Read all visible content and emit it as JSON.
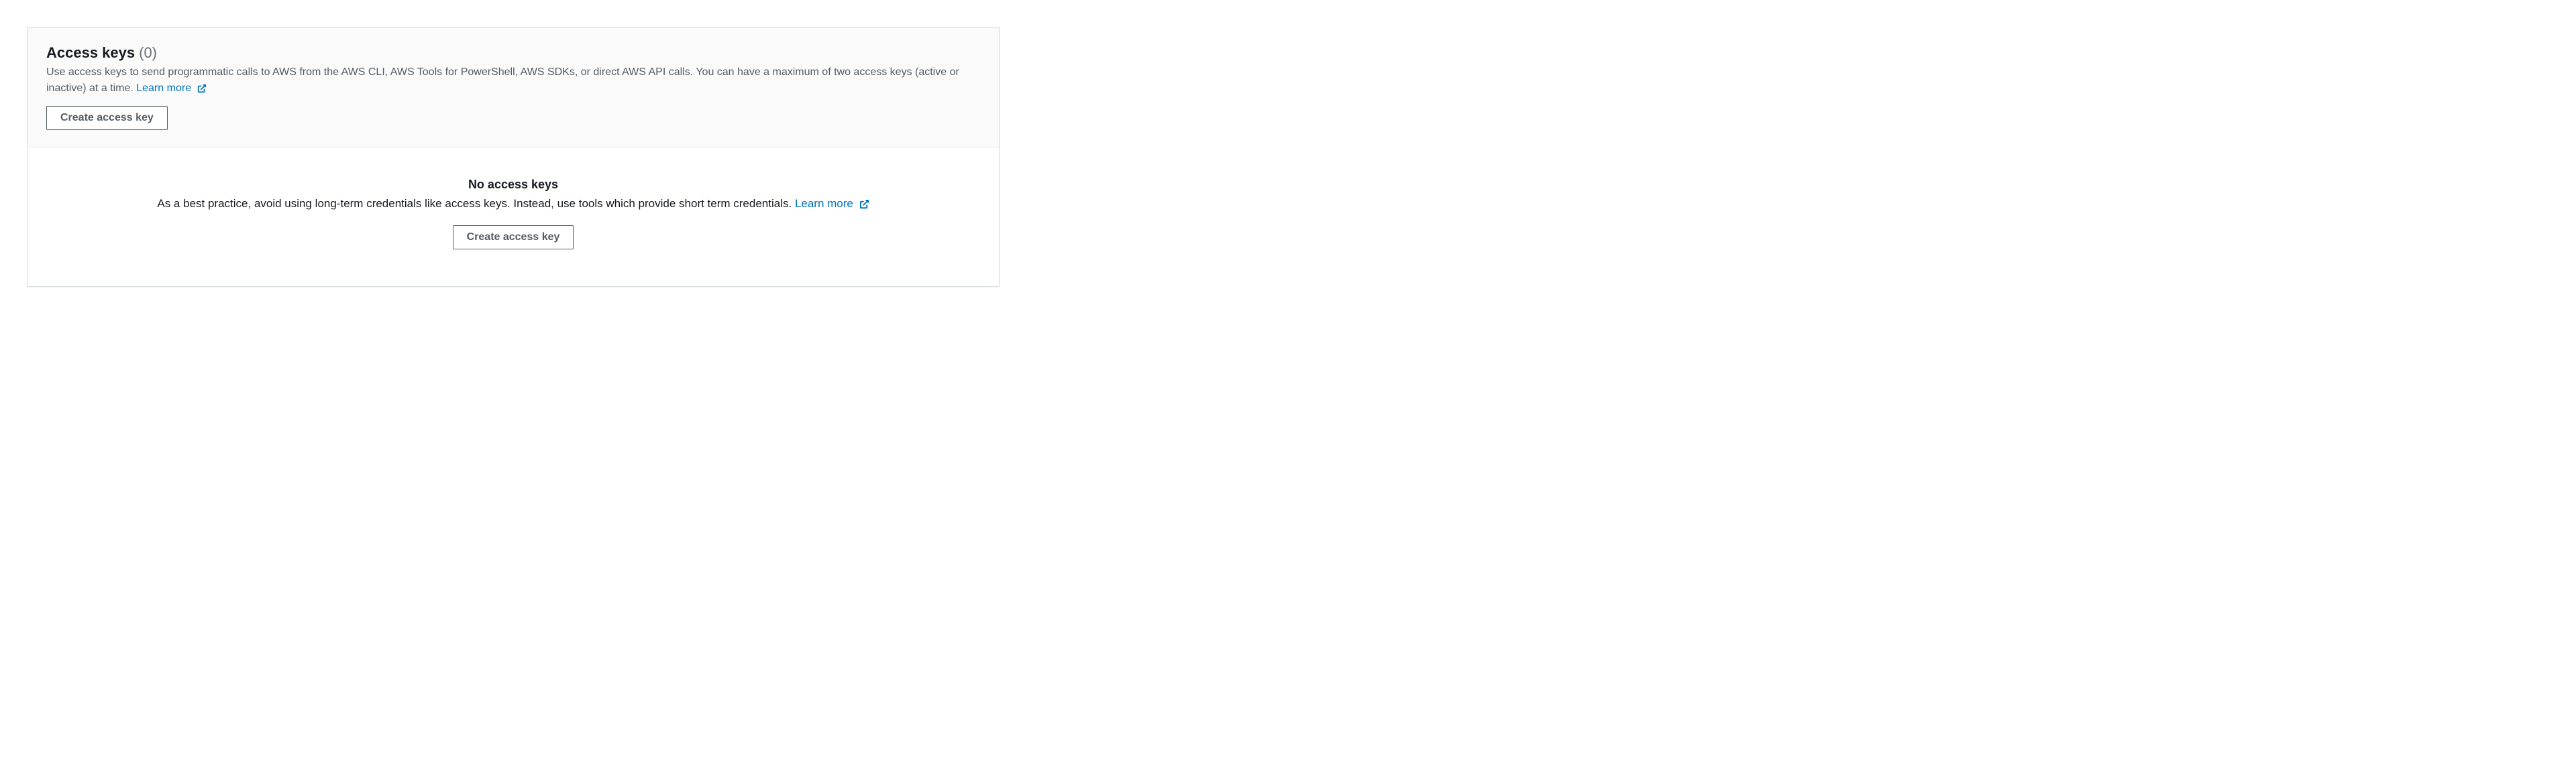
{
  "header": {
    "title": "Access keys",
    "count": "(0)",
    "description_text": "Use access keys to send programmatic calls to AWS from the AWS CLI, AWS Tools for PowerShell, AWS SDKs, or direct AWS API calls. You can have a maximum of two access keys (active or inactive) at a time. ",
    "learn_more_label": "Learn more",
    "create_button_label": "Create access key"
  },
  "empty_state": {
    "title": "No access keys",
    "description_text": "As a best practice, avoid using long-term credentials like access keys. Instead, use tools which provide short term credentials. ",
    "learn_more_label": "Learn more",
    "create_button_label": "Create access key"
  },
  "colors": {
    "link": "#0073bb",
    "border": "#d5dbdb",
    "header_bg": "#fafafa",
    "text_secondary": "#687078"
  }
}
